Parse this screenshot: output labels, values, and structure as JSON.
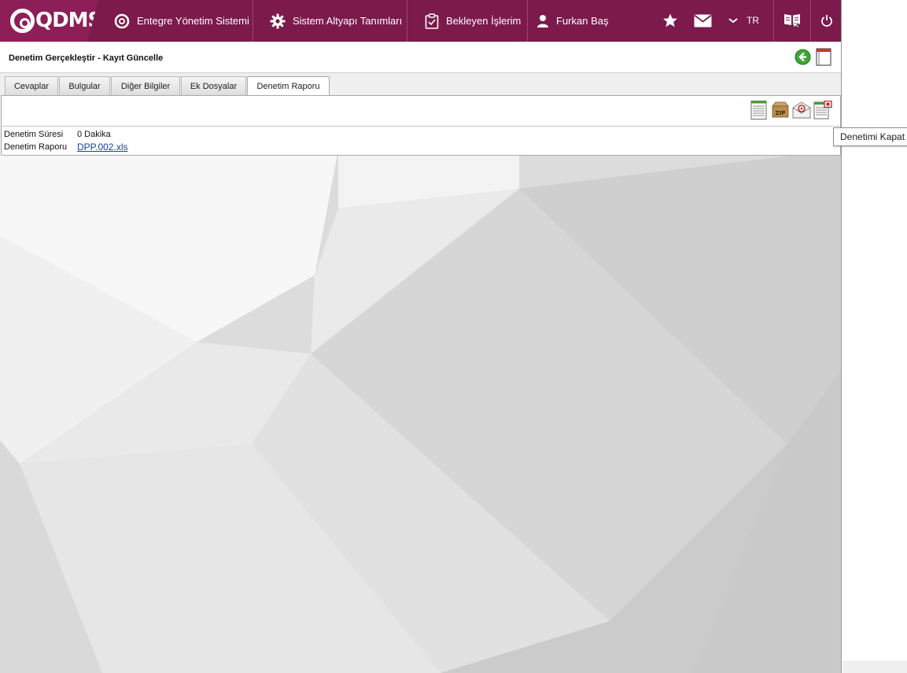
{
  "navbar": {
    "logo": "QDMS",
    "items": [
      {
        "label": "Entegre Yönetim Sistemi",
        "icon": "qdms-circle-icon"
      },
      {
        "label": "Sistem Altyapı Tanımları",
        "icon": "gear-icon"
      },
      {
        "label": "Bekleyen İşlerim",
        "icon": "clipboard-check-icon"
      },
      {
        "label": "Furkan Baş",
        "icon": "user-icon"
      }
    ],
    "language": "TR",
    "icons": [
      "star-icon",
      "mail-icon",
      "chevron-down-icon",
      "manual-book-icon",
      "power-icon"
    ],
    "colors": {
      "bar": "#7b1a4b",
      "logo": "#8e1e57"
    }
  },
  "page": {
    "title": "Denetim Gerçekleştir - Kayıt Güncelle",
    "header_icons": [
      "back-arrow-icon",
      "page-view-icon"
    ]
  },
  "tabs": [
    {
      "label": "Cevaplar",
      "active": false
    },
    {
      "label": "Bulgular",
      "active": false
    },
    {
      "label": "Diğer Bilgiler",
      "active": false
    },
    {
      "label": "Ek Dosyalar",
      "active": false
    },
    {
      "label": "Denetim Raporu",
      "active": true
    }
  ],
  "toolbar": {
    "icons": [
      "report-sheet-icon",
      "zip-archive-icon",
      "email-envelope-icon",
      "close-audit-icon"
    ]
  },
  "fields": {
    "duration_label": "Denetim Süresi",
    "duration_value": "0 Dakika",
    "report_label": "Denetim Raporu",
    "report_value": "DPP.002.xls"
  },
  "tooltip": "Denetimi Kapat"
}
